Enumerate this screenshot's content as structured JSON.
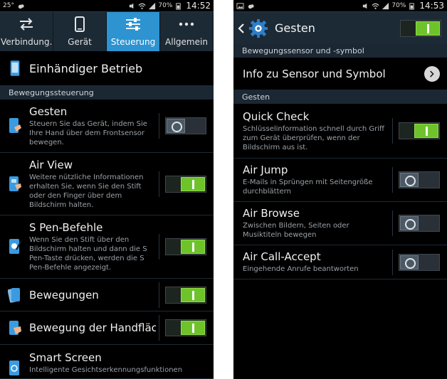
{
  "left": {
    "status": {
      "temp": "25°",
      "battery": "70%",
      "time": "14:52"
    },
    "tabs": [
      {
        "label": "Verbindung..",
        "icon": "arrows-icon",
        "active": false
      },
      {
        "label": "Gerät",
        "icon": "phone-icon",
        "active": false
      },
      {
        "label": "Steuerung",
        "icon": "sliders-icon",
        "active": true
      },
      {
        "label": "Allgemein",
        "icon": "more-icon",
        "active": false
      }
    ],
    "one_hand": {
      "title": "Einhändiger Betrieb"
    },
    "section_motion": "Bewegungssteuerung",
    "items": [
      {
        "title": "Gesten",
        "desc": "Steuern Sie das Gerät, indem Sie Ihre Hand über dem Frontsensor bewegen.",
        "state": "off"
      },
      {
        "title": "Air View",
        "desc": "Weitere nützliche Informationen erhalten Sie, wenn Sie den Stift oder den Finger über dem Bildschirm halten.",
        "state": "on"
      },
      {
        "title": "S Pen-Befehle",
        "desc": "Wenn Sie den Stift über den Bildschirm halten und dann die S Pen-Taste drücken, werden die S Pen-Befehle angezeigt.",
        "state": "on"
      },
      {
        "title": "Bewegungen",
        "desc": "",
        "state": "on"
      },
      {
        "title": "Bewegung der Handfläc..",
        "desc": "",
        "state": "on"
      },
      {
        "title": "Smart Screen",
        "desc": "Intelligente Gesichtserkennungsfunktionen",
        "state": ""
      }
    ]
  },
  "right": {
    "status": {
      "battery": "70%",
      "time": "14:53"
    },
    "header": {
      "title": "Gesten",
      "state": "on"
    },
    "section_sensor": "Bewegungssensor und -symbol",
    "info_row": {
      "title": "Info zu Sensor und Symbol"
    },
    "section_gestures": "Gesten",
    "items": [
      {
        "title": "Quick Check",
        "desc": "Schlüsselinformation schnell durch Griff zum Gerät überprüfen, wenn der Bildschirm aus ist.",
        "state": "on"
      },
      {
        "title": "Air Jump",
        "desc": "E-Mails in Sprüngen mit Seitengröße durchblättern",
        "state": "off"
      },
      {
        "title": "Air Browse",
        "desc": "Zwischen Bildern, Seiten oder Musiktiteln bewegen",
        "state": "off"
      },
      {
        "title": "Air Call-Accept",
        "desc": "Eingehende Anrufe beantworten",
        "state": "off"
      }
    ]
  },
  "colors": {
    "accent": "#2d93d1",
    "toggle_on": "#6ec32b",
    "header_bg": "#1c2a36",
    "section_bg": "#1b2733"
  }
}
